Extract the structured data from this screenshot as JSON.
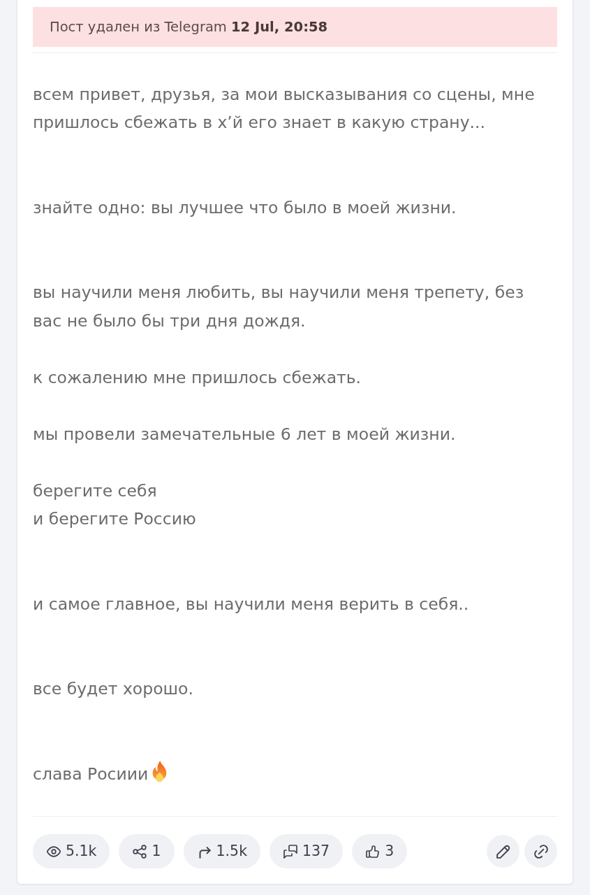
{
  "notice": {
    "text": "Пост удален из Telegram **12 Jul, 20:58**"
  },
  "sections": [
    {
      "paragraphs": [
        {
          "text": "всем привет, друзья, за мои высказывания со сцены, мне пришлось сбежать в х’й его знает в какую страну...",
          "ends_with_emoji": false
        }
      ]
    },
    {
      "paragraphs": [
        {
          "text": "знайте одно: вы лучшее что было в моей жизни.",
          "ends_with_emoji": false
        }
      ]
    },
    {
      "paragraphs": [
        {
          "text": "вы научили меня любить, вы научили меня трепету, без вас не было бы три дня дождя.",
          "ends_with_emoji": false
        },
        {
          "text": "к сожалению мне пришлось сбежать.",
          "ends_with_emoji": false
        },
        {
          "text": "мы провели замечательные 6 лет в моей жизни.",
          "ends_with_emoji": false
        },
        {
          "text": "берегите себя\nи берегите Россию",
          "ends_with_emoji": false
        }
      ]
    },
    {
      "paragraphs": [
        {
          "text": "и самое главное, вы научили меня верить в себя..",
          "ends_with_emoji": false
        }
      ]
    },
    {
      "paragraphs": [
        {
          "text": "все будет хорошо.",
          "ends_with_emoji": false
        }
      ]
    },
    {
      "paragraphs": [
        {
          "text": "слава Росиии",
          "ends_with_emoji": true
        }
      ]
    }
  ],
  "stats": [
    {
      "kind": "views",
      "value": "5.1k"
    },
    {
      "kind": "shares",
      "value": "1"
    },
    {
      "kind": "forwards",
      "value": "1.5k"
    },
    {
      "kind": "comments",
      "value": "137"
    },
    {
      "kind": "likes",
      "value": "3"
    }
  ],
  "actions": [
    {
      "kind": "edit"
    },
    {
      "kind": "link"
    }
  ]
}
